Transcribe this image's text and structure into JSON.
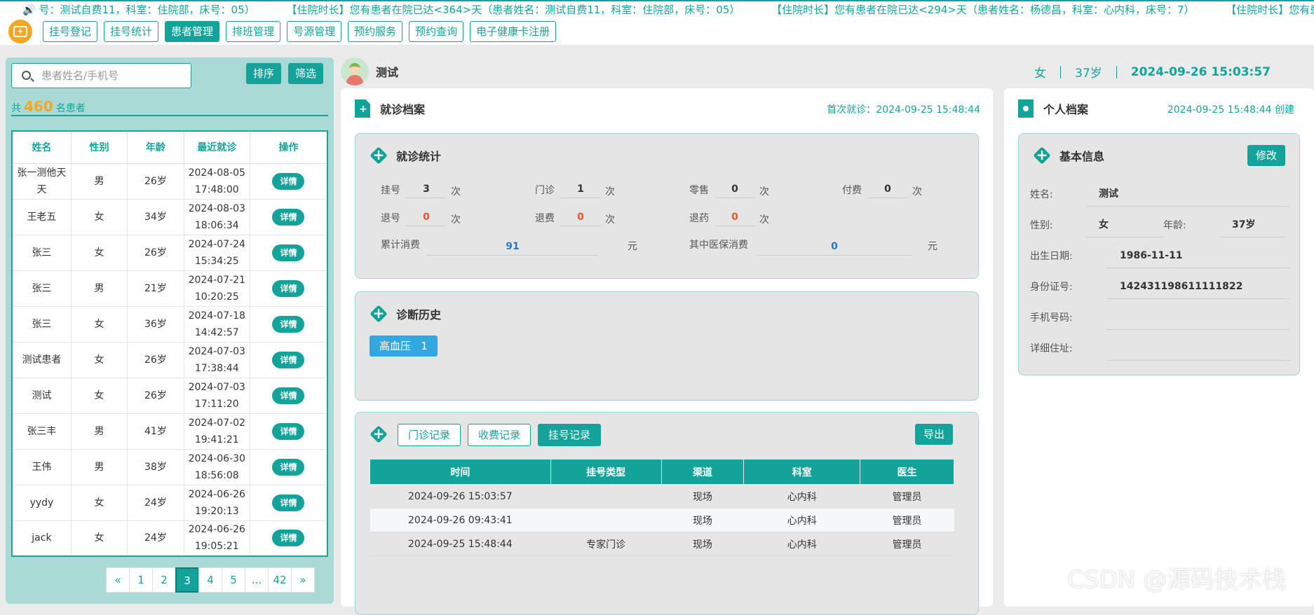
{
  "ticker": {
    "messages": [
      "号：测试自费11，科室：住院部，床号：05）",
      "【住院时长】您有患者在院已达<364>天（患者姓名：测试自费11，科室：住院部，床号：05）",
      "【住院时长】您有患者在院已达<294>天（患者姓名：杨德昌，科室：心内科，床号：7）",
      "【住院时长】您有患者在院"
    ]
  },
  "nav": {
    "items": [
      {
        "label": "挂号登记",
        "active": false
      },
      {
        "label": "挂号统计",
        "active": false
      },
      {
        "label": "患者管理",
        "active": true
      },
      {
        "label": "排班管理",
        "active": false
      },
      {
        "label": "号源管理",
        "active": false
      },
      {
        "label": "预约服务",
        "active": false
      },
      {
        "label": "预约查询",
        "active": false
      },
      {
        "label": "电子健康卡注册",
        "active": false
      }
    ]
  },
  "left": {
    "search_placeholder": "患者姓名/手机号",
    "sort_label": "排序",
    "filter_label": "筛选",
    "count_prefix": "共",
    "count": "460",
    "count_suffix": "名患者",
    "columns": [
      "姓名",
      "性别",
      "年龄",
      "最近就诊",
      "操作"
    ],
    "detail_label": "详情",
    "rows": [
      {
        "name": "张一测他天天",
        "sex": "男",
        "age": "26岁",
        "date": "2024-08-05",
        "time": "17:48:00"
      },
      {
        "name": "王老五",
        "sex": "女",
        "age": "34岁",
        "date": "2024-08-03",
        "time": "18:06:34"
      },
      {
        "name": "张三",
        "sex": "女",
        "age": "26岁",
        "date": "2024-07-24",
        "time": "15:34:25"
      },
      {
        "name": "张三",
        "sex": "男",
        "age": "21岁",
        "date": "2024-07-21",
        "time": "10:20:25"
      },
      {
        "name": "张三",
        "sex": "女",
        "age": "36岁",
        "date": "2024-07-18",
        "time": "14:42:57"
      },
      {
        "name": "测试患者",
        "sex": "女",
        "age": "26岁",
        "date": "2024-07-03",
        "time": "17:38:44"
      },
      {
        "name": "测试",
        "sex": "女",
        "age": "26岁",
        "date": "2024-07-03",
        "time": "17:11:20"
      },
      {
        "name": "张三丰",
        "sex": "男",
        "age": "41岁",
        "date": "2024-07-02",
        "time": "19:41:21"
      },
      {
        "name": "王伟",
        "sex": "男",
        "age": "38岁",
        "date": "2024-06-30",
        "time": "18:56:08"
      },
      {
        "name": "yydy",
        "sex": "女",
        "age": "24岁",
        "date": "2024-06-26",
        "time": "19:20:13"
      },
      {
        "name": "jack",
        "sex": "女",
        "age": "24岁",
        "date": "2024-06-26",
        "time": "19:05:21"
      }
    ],
    "pager": [
      "«",
      "1",
      "2",
      "3",
      "4",
      "5",
      "...",
      "42",
      "»"
    ],
    "pager_active": "3"
  },
  "patient": {
    "name": "测试",
    "sex": "女",
    "age": "37岁",
    "datetime": "2024-09-26 15:03:57"
  },
  "visit_archive": {
    "title": "就诊档案",
    "first_visit": "首次就诊：2024-09-25 15:48:44",
    "stats": {
      "title": "就诊统计",
      "guahao_label": "挂号",
      "guahao": "3",
      "menzhen_label": "门诊",
      "menzhen": "1",
      "lingshou_label": "零售",
      "lingshou": "0",
      "fufei_label": "付费",
      "fufei": "0",
      "tuihao_label": "退号",
      "tuihao": "0",
      "tuifei_label": "退费",
      "tuifei": "0",
      "tuiyao_label": "退药",
      "tuiyao": "0",
      "times_unit": "次",
      "total_label": "累计消费",
      "total": "91",
      "insurance_label": "其中医保消费",
      "insurance": "0",
      "money_unit": "元"
    },
    "diagnosis": {
      "title": "诊断历史",
      "tag": "高血压",
      "tag_count": "1"
    },
    "records": {
      "tabs": [
        {
          "label": "门诊记录",
          "active": false
        },
        {
          "label": "收费记录",
          "active": false
        },
        {
          "label": "挂号记录",
          "active": true
        }
      ],
      "export_label": "导出",
      "columns": [
        "时间",
        "挂号类型",
        "渠道",
        "科室",
        "医生"
      ],
      "rows": [
        {
          "time": "2024-09-26 15:03:57",
          "type": "",
          "channel": "现场",
          "dept": "心内科",
          "doctor": "管理员"
        },
        {
          "time": "2024-09-26 09:43:41",
          "type": "",
          "channel": "现场",
          "dept": "心内科",
          "doctor": "管理员"
        },
        {
          "time": "2024-09-25 15:48:44",
          "type": "专家门诊",
          "channel": "现场",
          "dept": "心内科",
          "doctor": "管理员"
        }
      ]
    }
  },
  "personal": {
    "title": "个人档案",
    "created": "2024-09-25 15:48:44 创建",
    "basic_title": "基本信息",
    "edit_label": "修改",
    "name_label": "姓名:",
    "name": "测试",
    "sex_label": "性别:",
    "sex": "女",
    "age_label": "年龄:",
    "age": "37岁",
    "birth_label": "出生日期:",
    "birth": "1986-11-11",
    "id_label": "身份证号:",
    "id": "142431198611111822",
    "phone_label": "手机号码:",
    "phone": "",
    "address_label": "详细住址:",
    "address": ""
  },
  "watermark": "CSDN @源码技术栈"
}
